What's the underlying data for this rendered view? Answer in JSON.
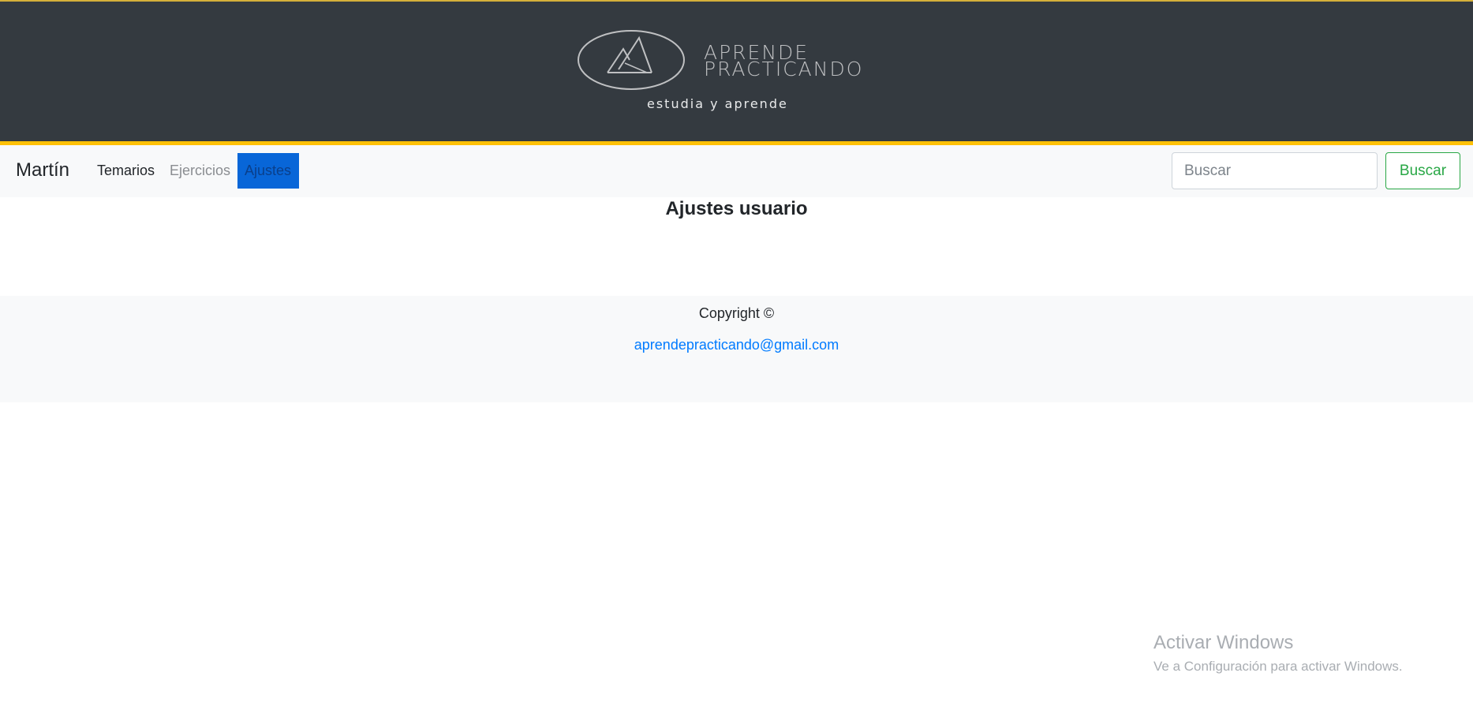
{
  "header": {
    "logo_line1": "APRENDE",
    "logo_line2": "PRACTICANDO",
    "tagline": "estudia y aprende",
    "accent_color": "#ffc107",
    "background_color": "#343a40"
  },
  "navbar": {
    "brand": "Martín",
    "links": [
      {
        "label": "Temarios"
      },
      {
        "label": "Ejercicios"
      },
      {
        "label": "Ajustes",
        "active": true
      }
    ],
    "search": {
      "placeholder": "Buscar",
      "value": "",
      "button_label": "Buscar",
      "button_color": "#28a745"
    }
  },
  "main": {
    "title": "Ajustes usuario"
  },
  "footer": {
    "copyright": "Copyright ©",
    "email": "aprendepracticando@gmail.com"
  },
  "watermark": {
    "title": "Activar Windows",
    "subtitle": "Ve a Configuración para activar Windows."
  }
}
